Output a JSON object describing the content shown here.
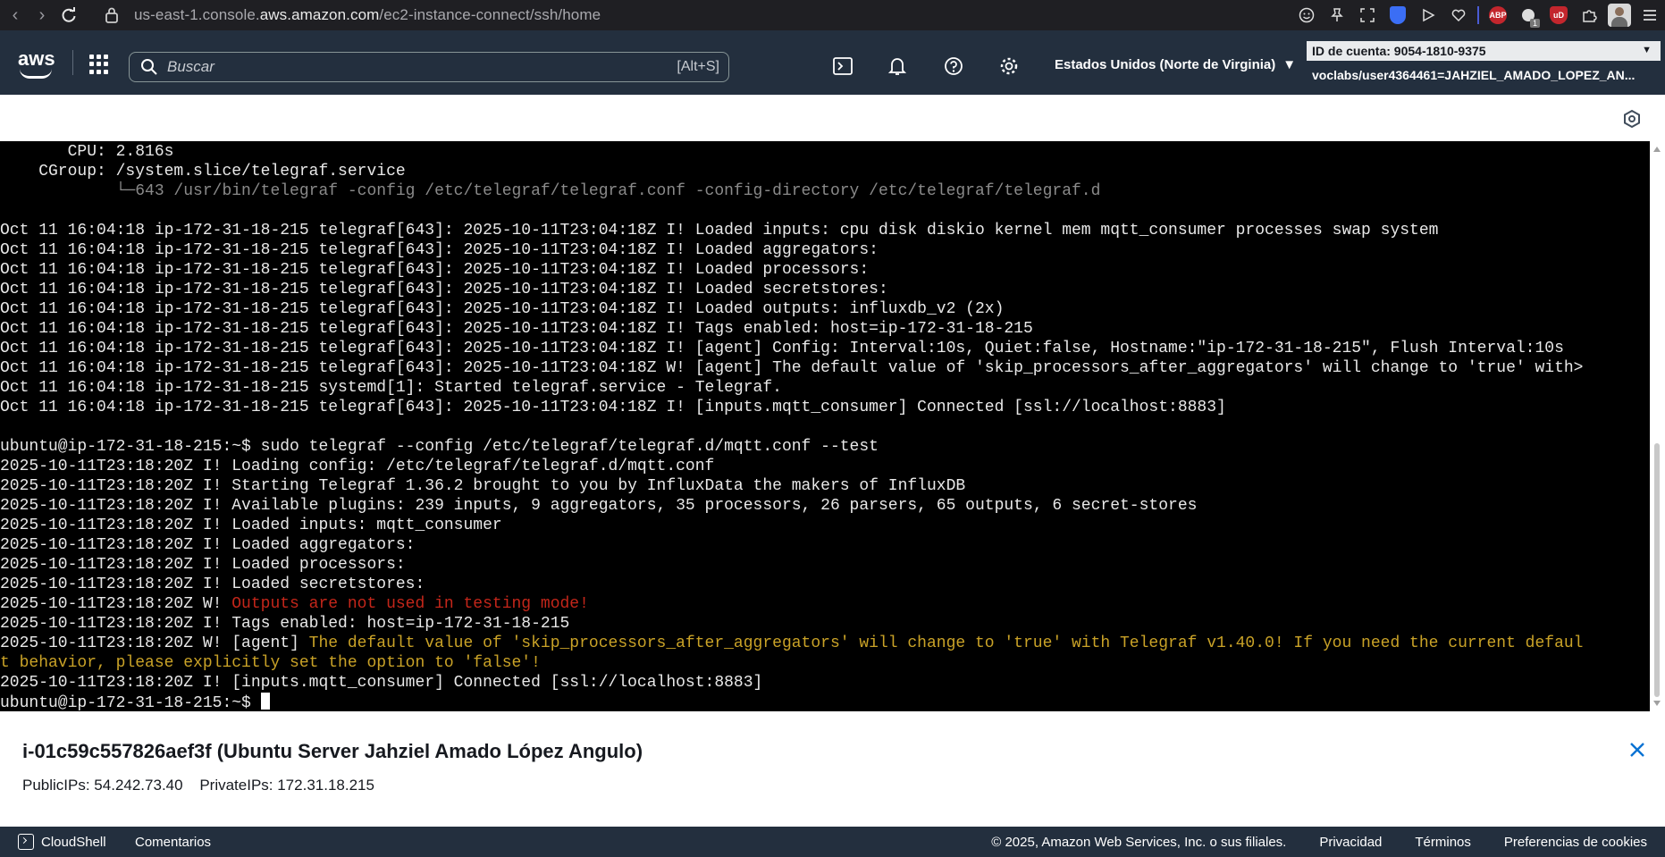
{
  "browser": {
    "url_prefix": "us-east-1.console.",
    "url_domain": "aws.amazon.com",
    "url_path": "/ec2-instance-connect/ssh/home",
    "extension_badge_abp": "ABP",
    "extension_badge_ud": "uD",
    "extension_count": "1"
  },
  "header": {
    "logo": "aws",
    "search_placeholder": "Buscar",
    "search_shortcut": "[Alt+S]",
    "region": "Estados Unidos (Norte de Virginia)",
    "account_id": "ID de cuenta: 9054-1810-9375",
    "user": "voclabs/user4364461=JAHZIEL_AMADO_LOPEZ_AN..."
  },
  "terminal": {
    "lines": [
      {
        "text": "       CPU: 2.816s",
        "style": ""
      },
      {
        "text": "    CGroup: /system.slice/telegraf.service",
        "style": ""
      },
      {
        "text": "            └─643 /usr/bin/telegraf -config /etc/telegraf/telegraf.conf -config-directory /etc/telegraf/telegraf.d",
        "style": "dim"
      },
      {
        "text": "",
        "style": ""
      },
      {
        "text": "Oct 11 16:04:18 ip-172-31-18-215 telegraf[643]: 2025-10-11T23:04:18Z I! Loaded inputs: cpu disk diskio kernel mem mqtt_consumer processes swap system",
        "style": ""
      },
      {
        "text": "Oct 11 16:04:18 ip-172-31-18-215 telegraf[643]: 2025-10-11T23:04:18Z I! Loaded aggregators:",
        "style": ""
      },
      {
        "text": "Oct 11 16:04:18 ip-172-31-18-215 telegraf[643]: 2025-10-11T23:04:18Z I! Loaded processors:",
        "style": ""
      },
      {
        "text": "Oct 11 16:04:18 ip-172-31-18-215 telegraf[643]: 2025-10-11T23:04:18Z I! Loaded secretstores:",
        "style": ""
      },
      {
        "text": "Oct 11 16:04:18 ip-172-31-18-215 telegraf[643]: 2025-10-11T23:04:18Z I! Loaded outputs: influxdb_v2 (2x)",
        "style": ""
      },
      {
        "text": "Oct 11 16:04:18 ip-172-31-18-215 telegraf[643]: 2025-10-11T23:04:18Z I! Tags enabled: host=ip-172-31-18-215",
        "style": ""
      },
      {
        "text": "Oct 11 16:04:18 ip-172-31-18-215 telegraf[643]: 2025-10-11T23:04:18Z I! [agent] Config: Interval:10s, Quiet:false, Hostname:\"ip-172-31-18-215\", Flush Interval:10s",
        "style": ""
      },
      {
        "text": "Oct 11 16:04:18 ip-172-31-18-215 telegraf[643]: 2025-10-11T23:04:18Z W! [agent] The default value of 'skip_processors_after_aggregators' will change to 'true' with>",
        "style": ""
      },
      {
        "text": "Oct 11 16:04:18 ip-172-31-18-215 systemd[1]: Started telegraf.service - Telegraf.",
        "style": ""
      },
      {
        "text": "Oct 11 16:04:18 ip-172-31-18-215 telegraf[643]: 2025-10-11T23:04:18Z I! [inputs.mqtt_consumer] Connected [ssl://localhost:8883]",
        "style": ""
      },
      {
        "text": "",
        "style": ""
      },
      {
        "text": "ubuntu@ip-172-31-18-215:~$ sudo telegraf --config /etc/telegraf/telegraf.d/mqtt.conf --test",
        "style": ""
      },
      {
        "text": "2025-10-11T23:18:20Z I! Loading config: /etc/telegraf/telegraf.d/mqtt.conf",
        "style": ""
      },
      {
        "text": "2025-10-11T23:18:20Z I! Starting Telegraf 1.36.2 brought to you by InfluxData the makers of InfluxDB",
        "style": ""
      },
      {
        "text": "2025-10-11T23:18:20Z I! Available plugins: 239 inputs, 9 aggregators, 35 processors, 26 parsers, 65 outputs, 6 secret-stores",
        "style": ""
      },
      {
        "text": "2025-10-11T23:18:20Z I! Loaded inputs: mqtt_consumer",
        "style": ""
      },
      {
        "text": "2025-10-11T23:18:20Z I! Loaded aggregators:",
        "style": ""
      },
      {
        "text": "2025-10-11T23:18:20Z I! Loaded processors:",
        "style": ""
      },
      {
        "text": "2025-10-11T23:18:20Z I! Loaded secretstores:",
        "style": ""
      },
      {
        "text": "2025-10-11T23:18:20Z W! ",
        "style": "",
        "tail": "Outputs are not used in testing mode!",
        "tail_style": "red"
      },
      {
        "text": "2025-10-11T23:18:20Z I! Tags enabled: host=ip-172-31-18-215",
        "style": ""
      },
      {
        "text": "2025-10-11T23:18:20Z W! [agent] ",
        "style": "",
        "tail": "The default value of 'skip_processors_after_aggregators' will change to 'true' with Telegraf v1.40.0! If you need the current defaul",
        "tail_style": "yellow"
      },
      {
        "text": "",
        "style": "",
        "tail": "t behavior, please explicitly set the option to 'false'!",
        "tail_style": "yellow"
      },
      {
        "text": "2025-10-11T23:18:20Z I! [inputs.mqtt_consumer] Connected [ssl://localhost:8883]",
        "style": ""
      },
      {
        "text": "ubuntu@ip-172-31-18-215:~$ ",
        "style": "",
        "cursor": true
      }
    ]
  },
  "instance": {
    "title": "i-01c59c557826aef3f (Ubuntu Server Jahziel Amado López Angulo)",
    "public_ips": "PublicIPs: 54.242.73.40",
    "private_ips": "PrivateIPs: 172.31.18.215"
  },
  "footer": {
    "cloudshell": "CloudShell",
    "comments": "Comentarios",
    "copyright": "© 2025, Amazon Web Services, Inc. o sus filiales.",
    "privacy": "Privacidad",
    "terms": "Términos",
    "cookies": "Preferencias de cookies"
  }
}
